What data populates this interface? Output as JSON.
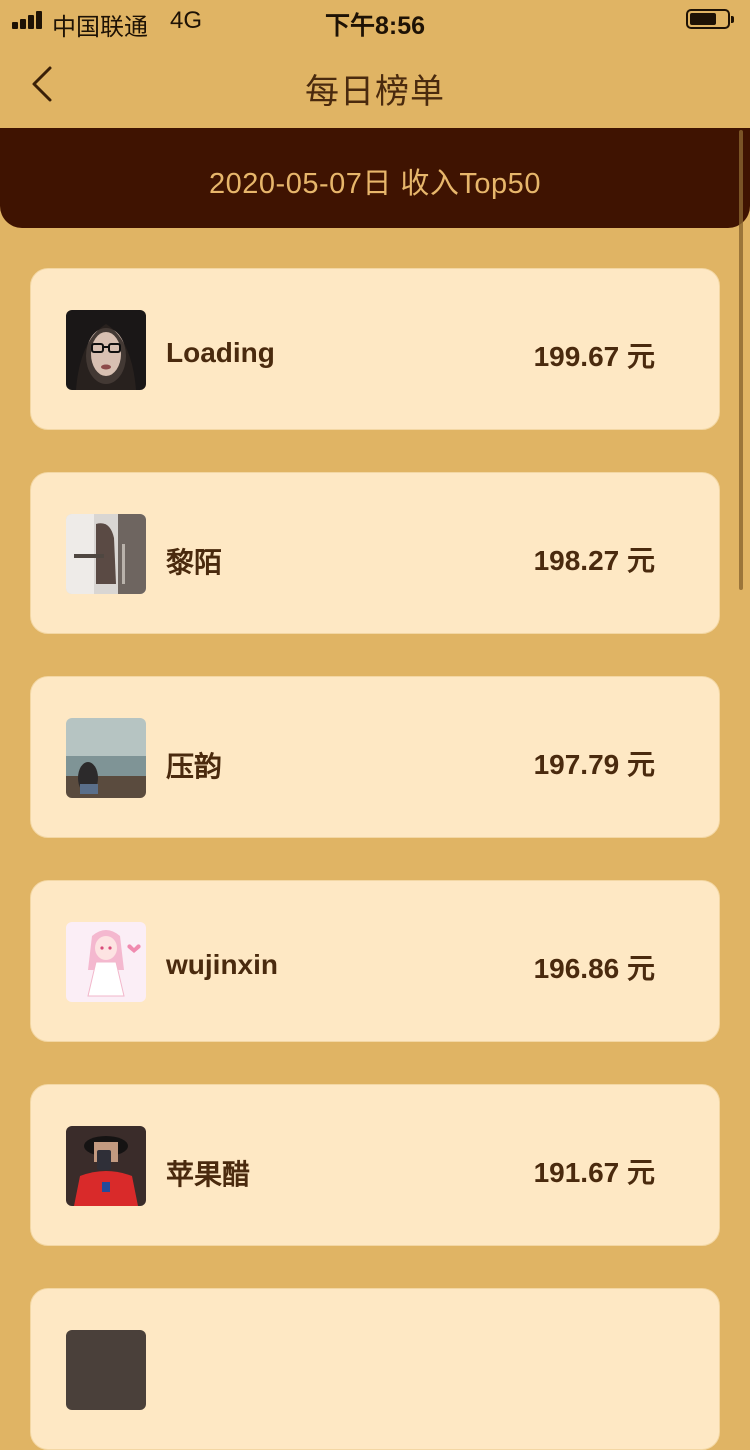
{
  "status_bar": {
    "carrier": "中国联通",
    "network": "4G",
    "time": "下午8:56"
  },
  "nav": {
    "title": "每日榜单",
    "back_icon": "chevron-left-icon"
  },
  "banner": {
    "text": "2020-05-07日 收入Top50"
  },
  "colors": {
    "page_bg": "#E0B464",
    "banner_bg": "#3F1301",
    "banner_text": "#E7B66B",
    "card_bg": "#FEE8C4",
    "text_dark": "#4A2A0E"
  },
  "ranking": [
    {
      "name": "Loading",
      "amount": "199.67 元",
      "avatar": "avatar-woman-glasses"
    },
    {
      "name": "黎陌",
      "amount": "198.27 元",
      "avatar": "avatar-woman-window"
    },
    {
      "name": "压韵",
      "amount": "197.79 元",
      "avatar": "avatar-girl-seaside"
    },
    {
      "name": "wujinxin",
      "amount": "196.86 元",
      "avatar": "avatar-anime-girl-pink"
    },
    {
      "name": "苹果醋",
      "amount": "191.67 元",
      "avatar": "avatar-man-red-shirt"
    },
    {
      "name": "",
      "amount": "",
      "avatar": "avatar-partial"
    }
  ]
}
